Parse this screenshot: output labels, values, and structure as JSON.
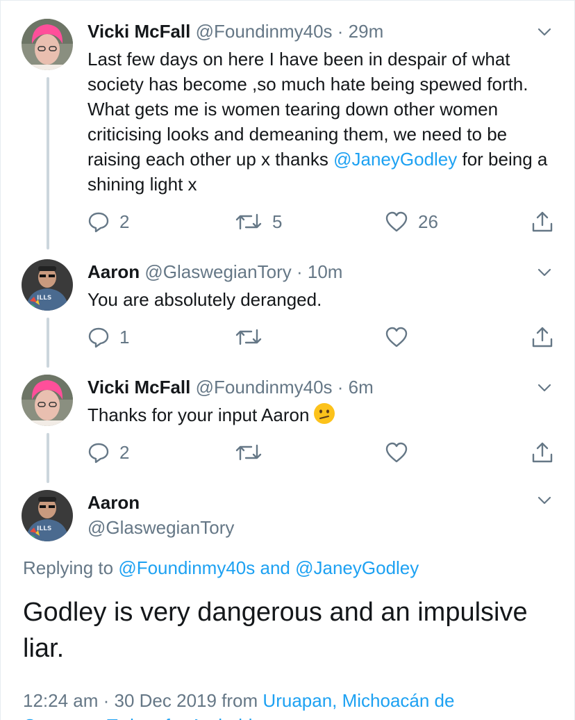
{
  "tweets": [
    {
      "name": "Vicki McFall",
      "handle": "@Foundinmy40s",
      "time": "29m",
      "text_before": "Last few days on here I have been in despair of what society has become ,so much hate being spewed forth. What gets me is women tearing down other women criticising looks and demeaning them, we need to be raising each other up x thanks ",
      "mention": "@JaneyGodley",
      "text_after": " for being a shining light x",
      "replies": "2",
      "retweets": "5",
      "likes": "26",
      "avatar_icon": "pink-hair-avatar-icon"
    },
    {
      "name": "Aaron",
      "handle": "@GlaswegianTory",
      "time": "10m",
      "text": "You are absolutely deranged.",
      "replies": "1",
      "retweets": "",
      "likes": "",
      "avatar_icon": "man-avatar-icon"
    },
    {
      "name": "Vicki McFall",
      "handle": "@Foundinmy40s",
      "time": "6m",
      "text": "Thanks for your input Aaron",
      "emoji": "confused-face-emoji",
      "replies": "2",
      "retweets": "",
      "likes": "",
      "avatar_icon": "pink-hair-avatar-icon"
    }
  ],
  "main_tweet": {
    "name": "Aaron",
    "handle": "@GlaswegianTory",
    "replying_prefix": "Replying to",
    "replying_to_1": "@Foundinmy40s",
    "replying_and": "and",
    "replying_to_2": "@JaneyGodley",
    "text": "Godley is very dangerous and an impulsive liar.",
    "timestamp": "12:24 am · 30 Dec 2019 from",
    "location": "Uruapan, Michoacán de",
    "footer_cutoff": "Ocampo · Twitter for Android"
  },
  "colors": {
    "accent": "#1da1f2",
    "muted": "#657786",
    "text": "#14171a",
    "thread_line": "#ccd6dd"
  }
}
